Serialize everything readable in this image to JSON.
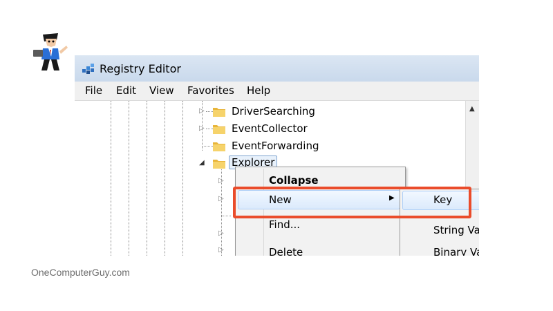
{
  "window": {
    "title": "Registry Editor"
  },
  "menu": [
    "File",
    "Edit",
    "View",
    "Favorites",
    "Help"
  ],
  "tree": {
    "items": [
      {
        "label": "DriverSearching",
        "expander": "▷"
      },
      {
        "label": "EventCollector",
        "expander": "▷"
      },
      {
        "label": "EventForwarding",
        "expander": ""
      },
      {
        "label": "Explorer",
        "expander": "◢",
        "selected": true
      }
    ],
    "children_expanders": [
      "▷",
      "▷",
      "",
      "▷",
      "▷"
    ]
  },
  "context_menu": {
    "items": [
      "Collapse",
      "New",
      "Find...",
      "Delete"
    ],
    "highlighted": "New",
    "submenu_arrow": "▶"
  },
  "submenu": {
    "items": [
      "Key",
      "String Va",
      "Binary Va"
    ],
    "highlighted": "Key"
  },
  "scrollbar": {
    "up_arrow": "▲"
  },
  "caption": "OneComputerGuy.com",
  "colors": {
    "highlight_border": "#ea4c2b",
    "titlebar": "#c9d9ec",
    "menu_bg": "#f2f2f2"
  },
  "icons": {
    "logo": "computer-guy-mascot-icon",
    "app": "registry-editor-icon",
    "folder": "folder-icon"
  }
}
